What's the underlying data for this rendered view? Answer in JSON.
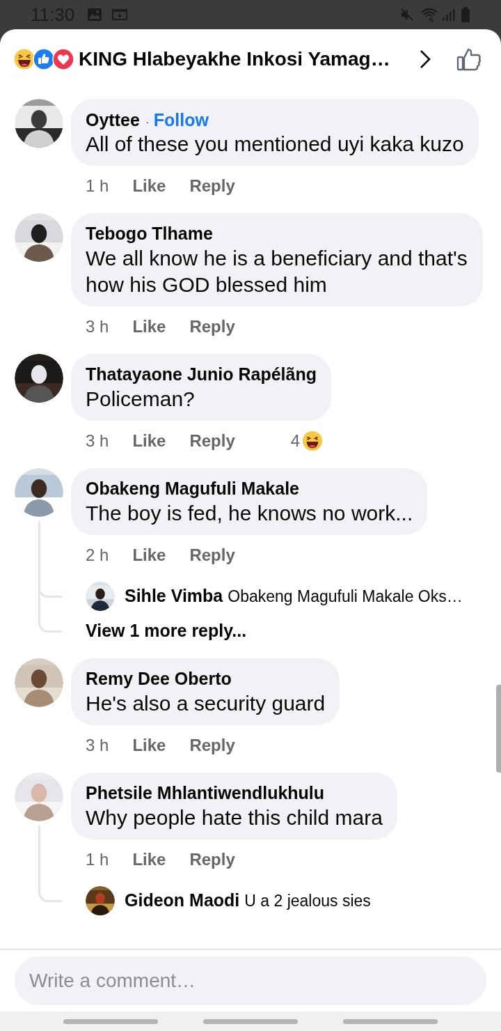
{
  "status_bar": {
    "time": "11:30"
  },
  "header": {
    "title": "KING Hlabeyakhe Inkosi Yamag…"
  },
  "comments": [
    {
      "name": "Oyttee",
      "separator": "·",
      "follow": "Follow",
      "text": "All of these you mentioned uyi kaka kuzo",
      "time": "1 h",
      "like": "Like",
      "reply": "Reply"
    },
    {
      "name": "Tebogo Tlhame",
      "text": "We all know he is a beneficiary and that's how his GOD blessed him",
      "time": "3 h",
      "like": "Like",
      "reply": "Reply"
    },
    {
      "name": "Thatayaone Junio Rapélãng",
      "text": "Policeman?",
      "time": "3 h",
      "like": "Like",
      "reply": "Reply",
      "reaction_count": "4"
    },
    {
      "name": "Obakeng Magufuli Makale",
      "text": "The boy is fed, he knows no work...",
      "time": "2 h",
      "like": "Like",
      "reply": "Reply",
      "replies": [
        {
          "name": "Sihle Vimba",
          "text": "Obakeng Magufuli Makale Oks…"
        }
      ],
      "more_replies": "View 1 more reply..."
    },
    {
      "name": "Remy Dee Oberto",
      "text": "He's also a security guard",
      "time": "3 h",
      "like": "Like",
      "reply": "Reply"
    },
    {
      "name": "Phetsile Mhlantiwendlukhulu",
      "text": "Why people hate this child mara",
      "time": "1 h",
      "like": "Like",
      "reply": "Reply",
      "replies": [
        {
          "name": "Gideon Maodi",
          "text": "U a 2 jealous sies"
        }
      ]
    }
  ],
  "composer": {
    "placeholder": "Write a comment…"
  }
}
